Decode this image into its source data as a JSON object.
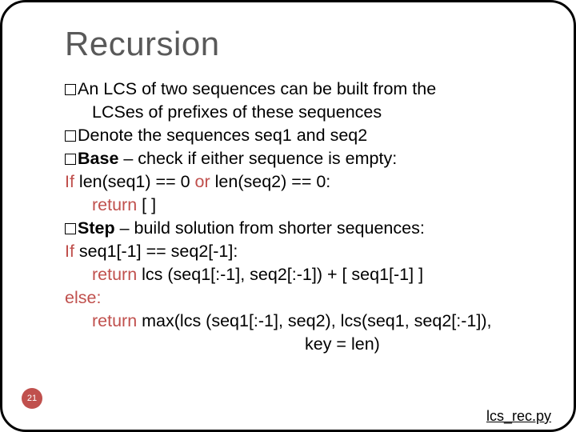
{
  "title": "Recursion",
  "page_number": "21",
  "file_link": "lcs_rec.py",
  "lines": {
    "l1a": "An LCS of two sequences can be built from the",
    "l1b": "LCSes of prefixes of these sequences",
    "l2": "Denote the sequences seq1 and seq2",
    "l3a": "Base",
    "l3b": " – check if either sequence is empty:",
    "l4a": "If ",
    "l4b": "len(seq1) == 0",
    "l4c": " or ",
    "l4d": "len(seq2) == 0:",
    "l5a": "return",
    "l5b": " [ ]",
    "l6a": "Step",
    "l6b": " – build solution from shorter sequences:",
    "l7a": "If ",
    "l7b": "seq1[-1] == seq2[-1]:",
    "l8a": "return",
    "l8b": " lcs (seq1[:-1], seq2[:-1]) + [ seq1[-1] ]",
    "l9": "else:",
    "l10a": "return",
    "l10b": " max(lcs (seq1[:-1], seq2), lcs(seq1, seq2[:-1]),",
    "l11": "key = len)"
  }
}
